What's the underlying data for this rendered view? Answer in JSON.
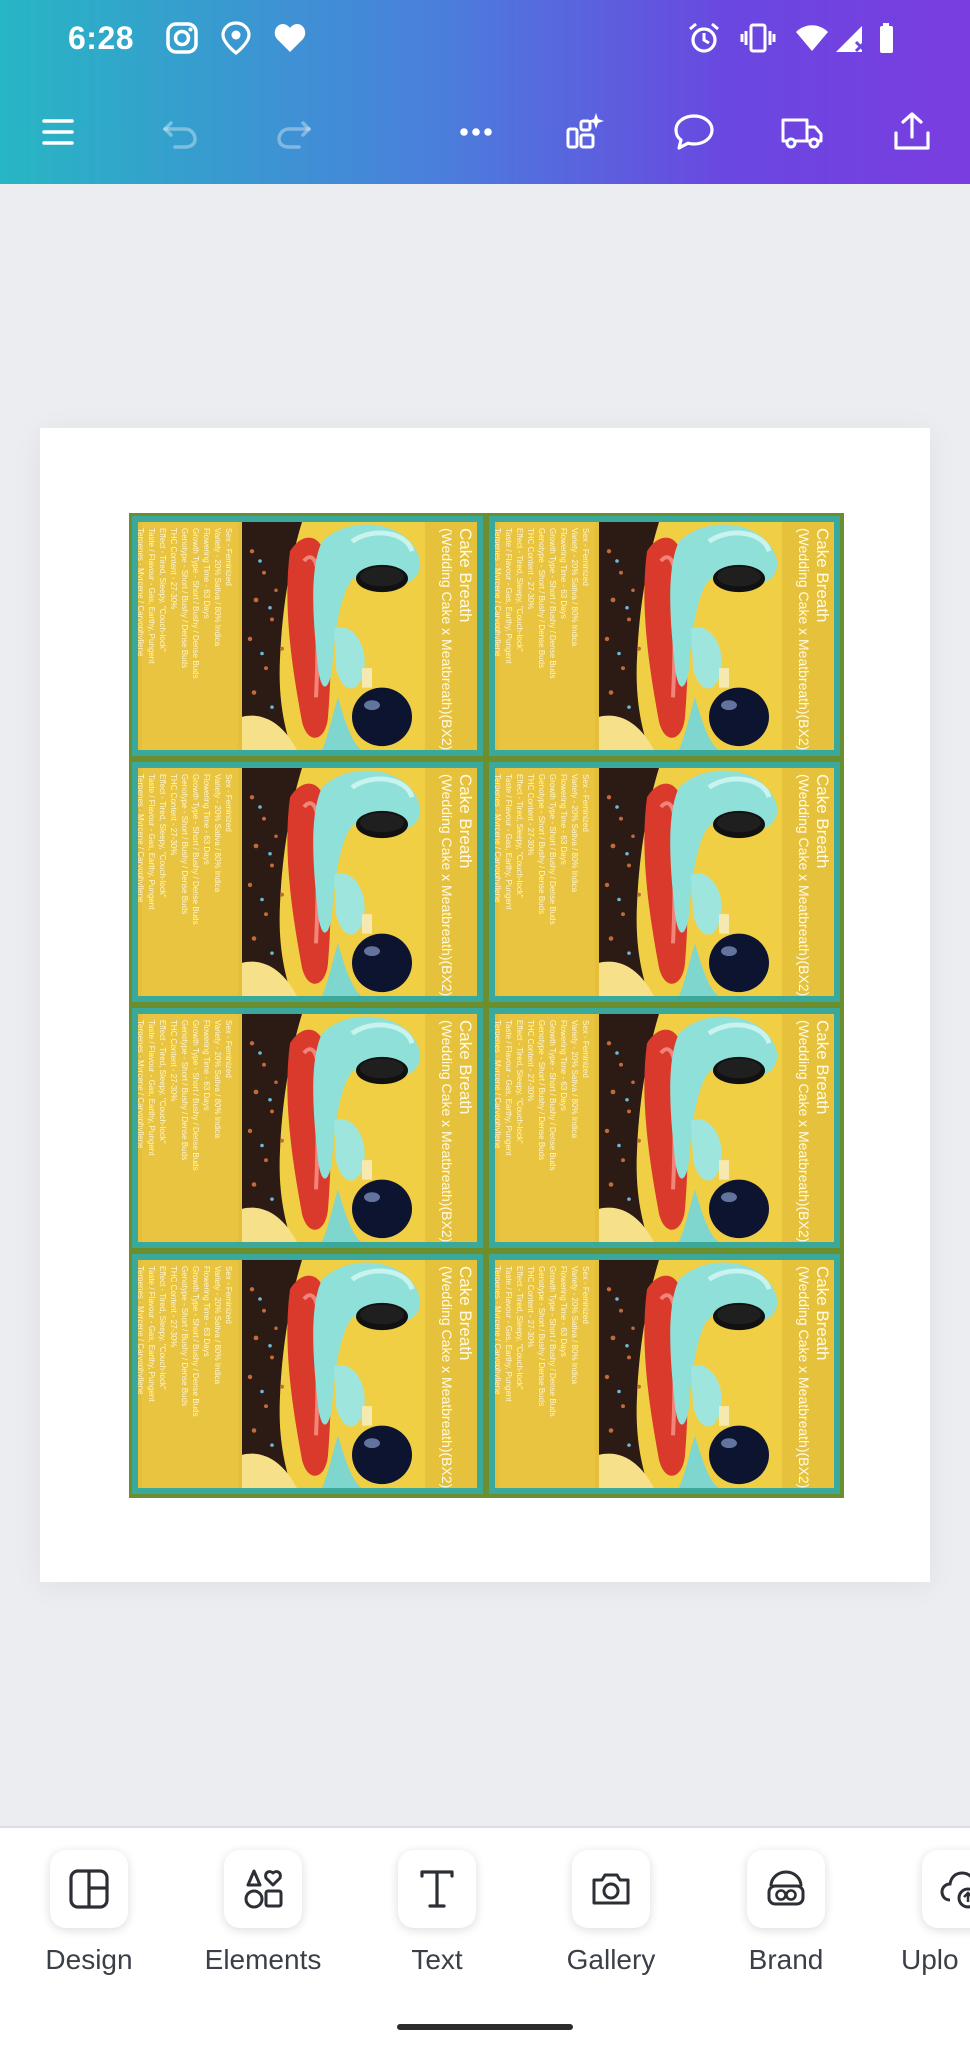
{
  "status_bar": {
    "time": "6:28",
    "left_icons": [
      "instagram-icon",
      "location-pin-icon",
      "heart-icon"
    ],
    "right_icons": [
      "alarm-icon",
      "vibrate-icon",
      "wifi-icon",
      "signal-icon",
      "battery-icon"
    ]
  },
  "toolbar": {
    "buttons": [
      "menu-icon",
      "undo-icon",
      "redo-icon",
      "more-icon",
      "magic-design-icon",
      "comment-icon",
      "print-delivery-icon",
      "share-icon"
    ]
  },
  "colors": {
    "gradient_start": "#27b6c3",
    "gradient_end": "#7a3de0",
    "label_teal": "#3aa99c",
    "label_yellow": "#e5be3a"
  },
  "label_card": {
    "title": "Cake Breath",
    "subtitle": "(Wedding Cake x Meatbreath)",
    "code": "(BX2)",
    "details": [
      "Sex - Feminized",
      "Variety - 20% Sativa / 80% Indica",
      "Flowering Time - 63 Days",
      "Growth Type - Short / Bushy / Dense Buds",
      "Genotype - Short / Bushy / Dense Buds",
      "THC Content - 27-30%",
      "Effect - Tired, Sleepy, \"Couch-lock\"",
      "Taste / Flavour - Gas, Earthy, Pungent",
      "Terpenes - Myrcene / Caryophyllene"
    ]
  },
  "bottom_nav": {
    "items": [
      {
        "label": "Design",
        "icon": "design-icon"
      },
      {
        "label": "Elements",
        "icon": "elements-icon"
      },
      {
        "label": "Text",
        "icon": "text-icon"
      },
      {
        "label": "Gallery",
        "icon": "camera-icon"
      },
      {
        "label": "Brand",
        "icon": "brand-icon"
      },
      {
        "label": "Uplo",
        "icon": "upload-icon"
      }
    ]
  }
}
